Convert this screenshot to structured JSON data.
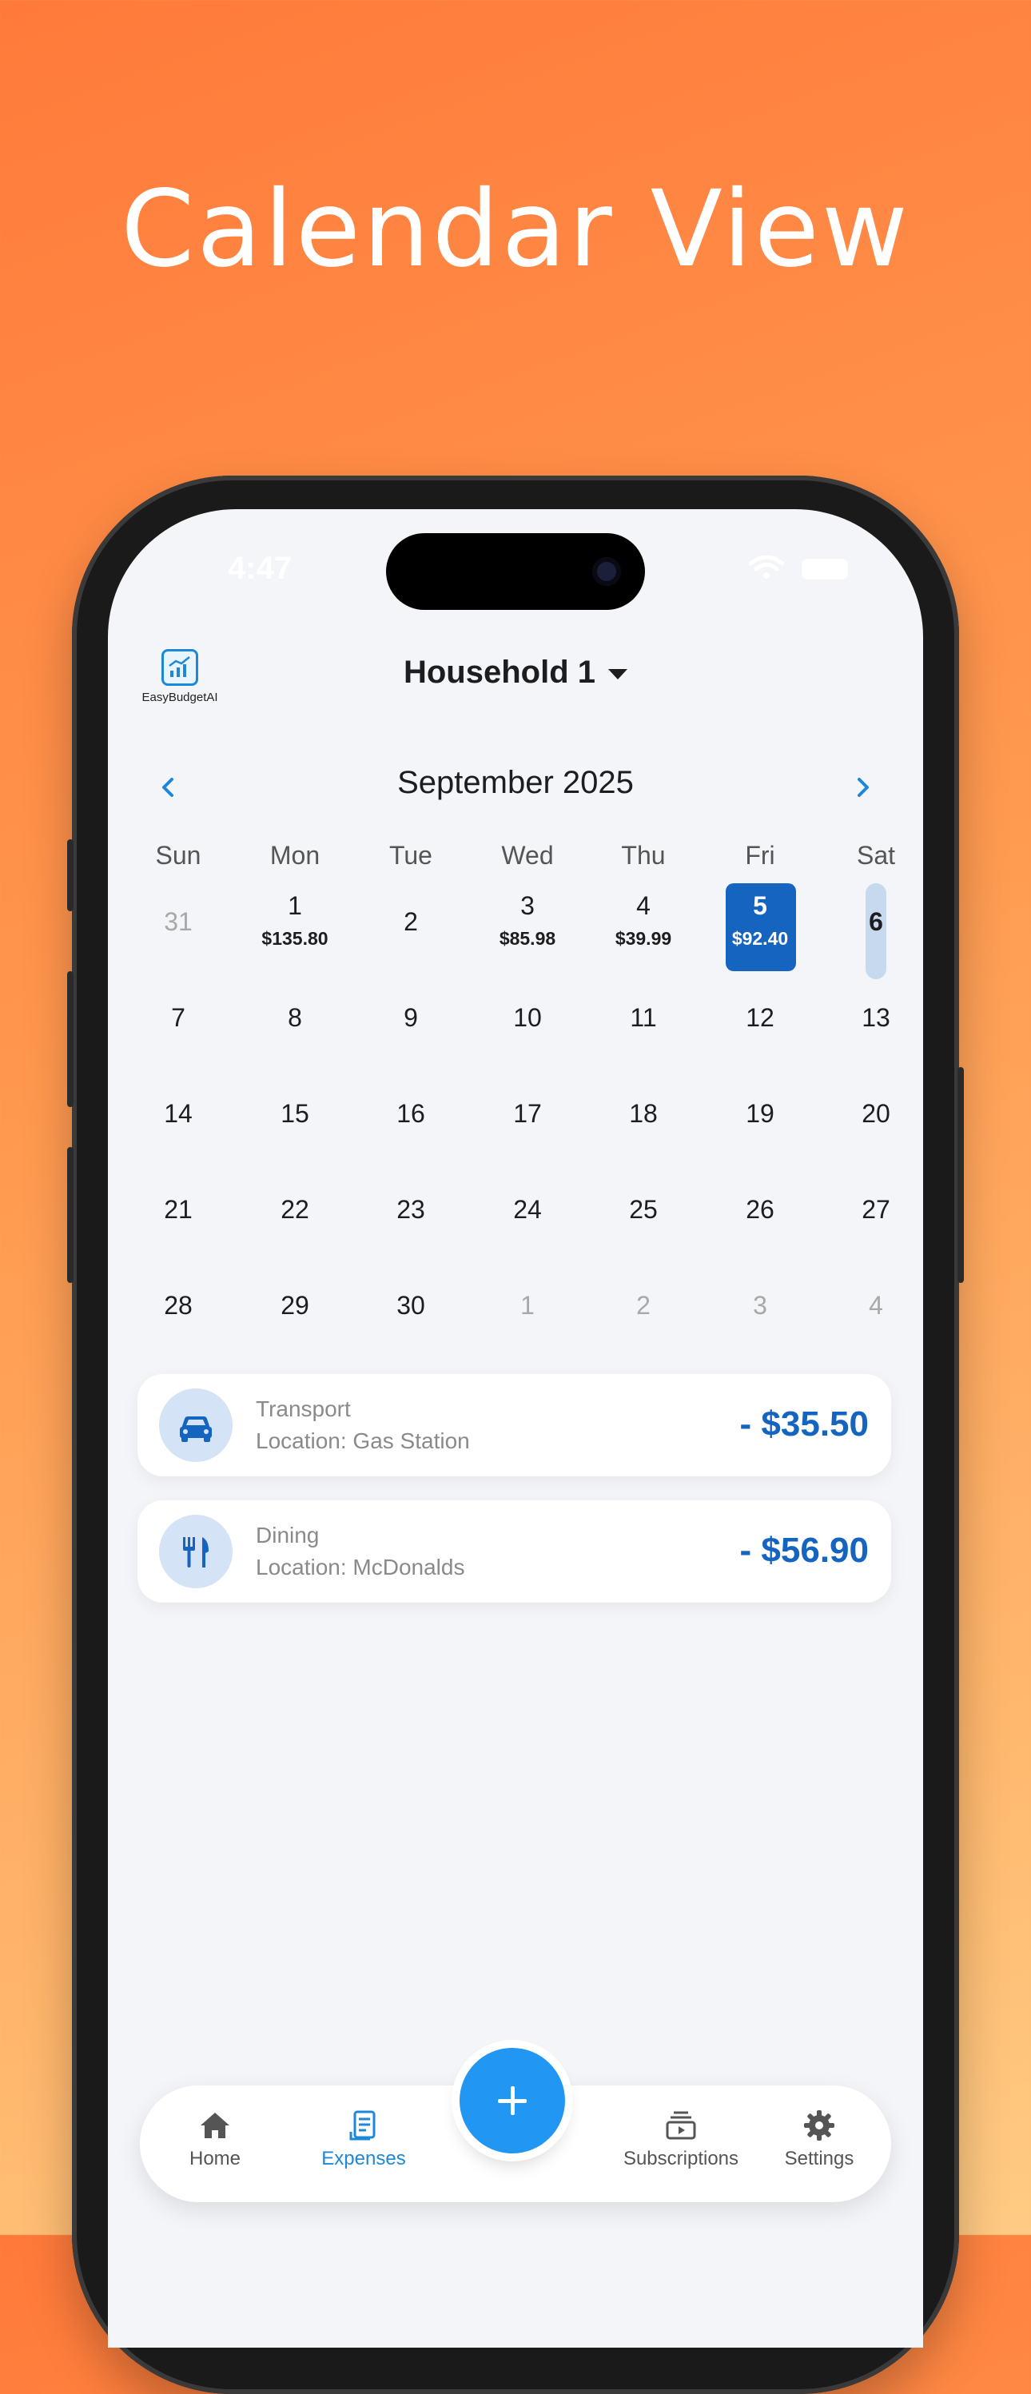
{
  "headline": "Calendar View",
  "status": {
    "time": "4:47"
  },
  "app": {
    "logo_text": "EasyBudgetAI"
  },
  "header": {
    "household": "Household 1"
  },
  "calendar": {
    "month_title": "September 2025",
    "weekdays": [
      "Sun",
      "Mon",
      "Tue",
      "Wed",
      "Thu",
      "Fri",
      "Sat"
    ],
    "weeks": [
      [
        {
          "day": "31",
          "muted": true
        },
        {
          "day": "1",
          "amount": "$135.80"
        },
        {
          "day": "2"
        },
        {
          "day": "3",
          "amount": "$85.98"
        },
        {
          "day": "4",
          "amount": "$39.99"
        },
        {
          "day": "5",
          "amount": "$92.40",
          "selected": true
        },
        {
          "day": "6",
          "today": true
        }
      ],
      [
        {
          "day": "7"
        },
        {
          "day": "8"
        },
        {
          "day": "9"
        },
        {
          "day": "10"
        },
        {
          "day": "11"
        },
        {
          "day": "12"
        },
        {
          "day": "13"
        }
      ],
      [
        {
          "day": "14"
        },
        {
          "day": "15"
        },
        {
          "day": "16"
        },
        {
          "day": "17"
        },
        {
          "day": "18"
        },
        {
          "day": "19"
        },
        {
          "day": "20"
        }
      ],
      [
        {
          "day": "21"
        },
        {
          "day": "22"
        },
        {
          "day": "23"
        },
        {
          "day": "24"
        },
        {
          "day": "25"
        },
        {
          "day": "26"
        },
        {
          "day": "27"
        }
      ],
      [
        {
          "day": "28"
        },
        {
          "day": "29"
        },
        {
          "day": "30"
        },
        {
          "day": "1",
          "muted": true
        },
        {
          "day": "2",
          "muted": true
        },
        {
          "day": "3",
          "muted": true
        },
        {
          "day": "4",
          "muted": true
        }
      ]
    ]
  },
  "transactions": [
    {
      "icon": "car-icon",
      "category": "Transport",
      "location": "Location: Gas Station",
      "amount": "- $35.50"
    },
    {
      "icon": "fork-knife-icon",
      "category": "Dining",
      "location": "Location: McDonalds",
      "amount": "- $56.90"
    }
  ],
  "tabbar": {
    "home": "Home",
    "expenses": "Expenses",
    "subscriptions": "Subscriptions",
    "settings": "Settings",
    "active": "expenses"
  },
  "colors": {
    "accent": "#1e88d8",
    "selected_day": "#1565c0",
    "fab": "#2196f3",
    "background_top": "#ff7a3a",
    "background_bottom": "#ffcb84"
  }
}
